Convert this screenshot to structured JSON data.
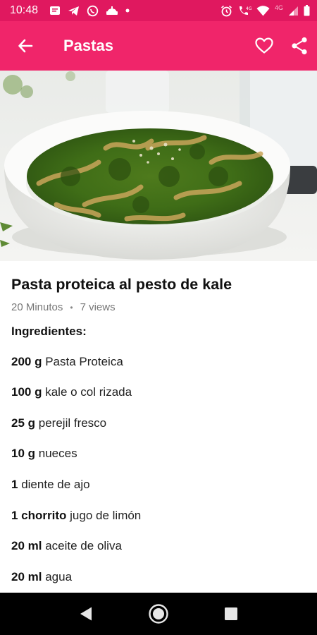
{
  "status_bar": {
    "time": "10:48",
    "network_label": "4G",
    "left_icons": [
      "message-icon",
      "telegram-icon",
      "whatsapp-icon",
      "food-app-icon",
      "dot-icon"
    ],
    "right_icons": [
      "alarm-icon",
      "volte-icon",
      "wifi-icon",
      "signal-icon",
      "battery-icon"
    ]
  },
  "app_bar": {
    "title": "Pastas",
    "color": "#f0256a",
    "status_color": "#e0185f"
  },
  "recipe": {
    "title": "Pasta proteica al pesto de kale",
    "duration": "20 Minutos",
    "separator": "•",
    "views": "7 views",
    "ingredients_heading": "Ingredientes:",
    "ingredients": [
      {
        "qty": "200 g",
        "name": "Pasta Proteica"
      },
      {
        "qty": "100 g",
        "name": "kale o col rizada"
      },
      {
        "qty": "25 g",
        "name": "perejil fresco"
      },
      {
        "qty": "10 g",
        "name": "nueces"
      },
      {
        "qty": "1",
        "name": "diente de ajo"
      },
      {
        "qty": "1 chorrito",
        "name": "jugo de limón"
      },
      {
        "qty": "20 ml",
        "name": "aceite de oliva"
      },
      {
        "qty": "20 ml",
        "name": "agua"
      }
    ]
  },
  "nav_bar": {
    "buttons": [
      "back-triangle-icon",
      "home-circle-icon",
      "recents-square-icon"
    ]
  }
}
